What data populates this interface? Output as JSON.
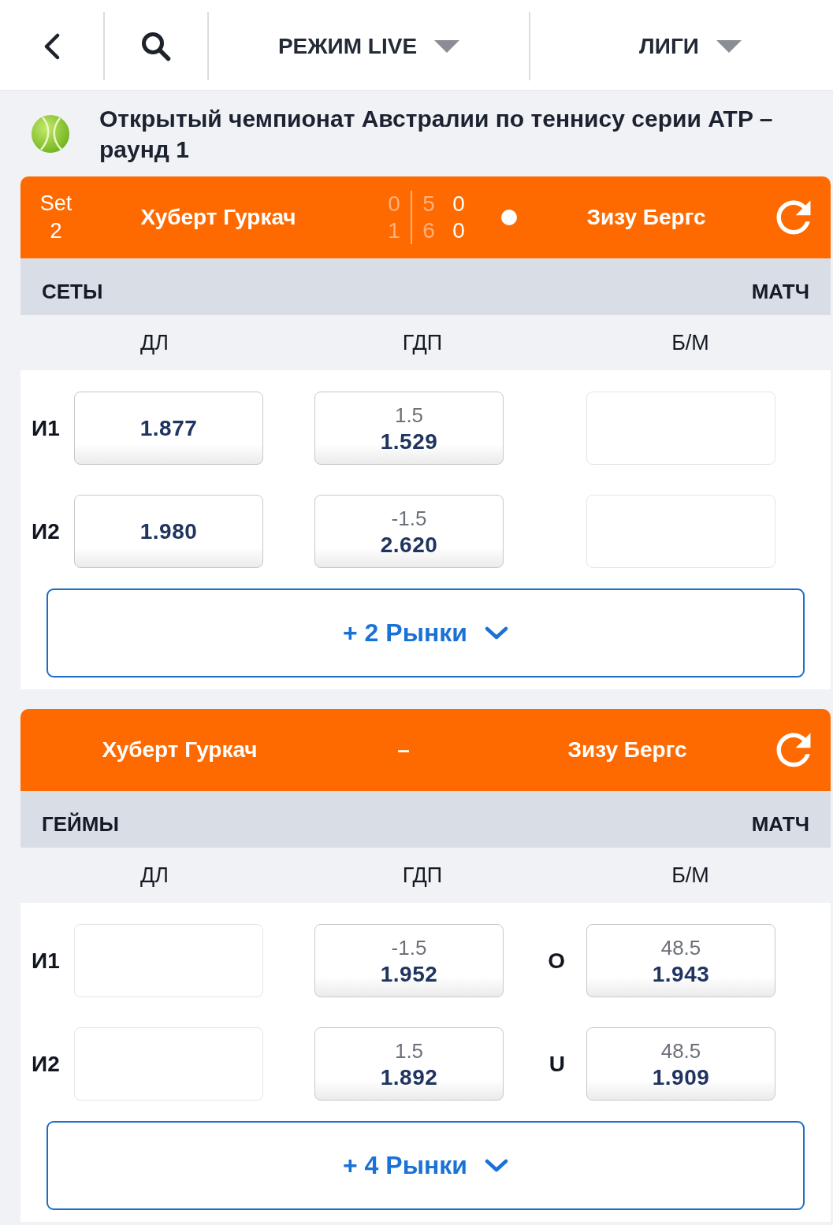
{
  "top_bar": {
    "dropdowns": [
      {
        "label": "РЕЖИМ LIVE"
      },
      {
        "label": "ЛИГИ"
      }
    ]
  },
  "tournament": {
    "title": "Открытый чемпионат Австралии по теннису серии ATP – раунд 1"
  },
  "events": [
    {
      "header": {
        "kind": "score",
        "set_label": "Set",
        "set_number": "2",
        "players": [
          {
            "name": "Хуберт Гуркач",
            "serving": false
          },
          {
            "name": "Зизу Бергс",
            "serving": true
          }
        ],
        "score": [
          {
            "values": [
              "0",
              "1"
            ],
            "muted": true
          },
          {
            "values": [
              "5",
              "6"
            ],
            "muted": true
          },
          {
            "values": [
              "0",
              "0"
            ],
            "muted": false
          }
        ]
      },
      "market": {
        "title": "СЕТЫ",
        "scope": "МАТЧ",
        "columns": [
          "ДЛ",
          "ГДП",
          "Б/М"
        ],
        "rows": [
          {
            "label": "И1",
            "cells": [
              {
                "kind": "price",
                "value": "1.877"
              },
              {
                "kind": "price",
                "line": "1.5",
                "value": "1.529"
              },
              {
                "kind": "empty"
              }
            ]
          },
          {
            "label": "И2",
            "cells": [
              {
                "kind": "price",
                "value": "1.980"
              },
              {
                "kind": "price",
                "line": "-1.5",
                "value": "2.620"
              },
              {
                "kind": "empty"
              }
            ]
          }
        ],
        "more_button": "+ 2 Рынки"
      }
    },
    {
      "header": {
        "kind": "versus",
        "players": [
          {
            "name": "Хуберт Гуркач"
          },
          {
            "name": "Зизу Бергс"
          }
        ],
        "separator": "–"
      },
      "market": {
        "title": "ГЕЙМЫ",
        "scope": "МАТЧ",
        "columns": [
          "ДЛ",
          "ГДП",
          "Б/М"
        ],
        "rows": [
          {
            "label": "И1",
            "cells": [
              {
                "kind": "empty"
              },
              {
                "kind": "price",
                "line": "-1.5",
                "value": "1.952"
              },
              {
                "kind": "price",
                "prefix": "O",
                "line": "48.5",
                "value": "1.943"
              }
            ]
          },
          {
            "label": "И2",
            "cells": [
              {
                "kind": "empty"
              },
              {
                "kind": "price",
                "line": "1.5",
                "value": "1.892"
              },
              {
                "kind": "price",
                "prefix": "U",
                "line": "48.5",
                "value": "1.909"
              }
            ]
          }
        ],
        "more_button": "+ 4 Рынки"
      }
    }
  ]
}
